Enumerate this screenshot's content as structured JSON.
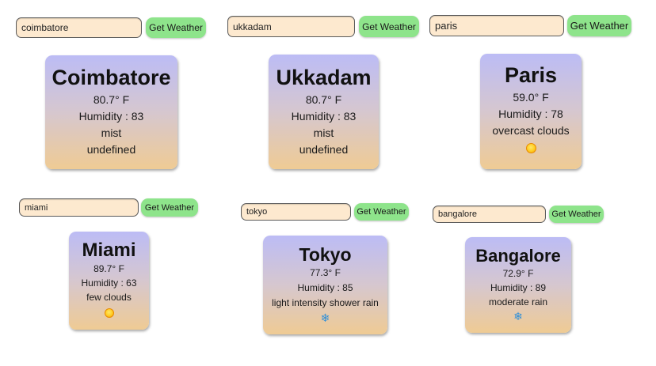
{
  "button_label": "Get Weather",
  "widgets": [
    {
      "query": "coimbatore",
      "city": "Coimbatore",
      "temperature": "80.7° F",
      "humidity": "Humidity : 83",
      "description": "mist",
      "extra": "undefined"
    },
    {
      "query": "ukkadam",
      "city": "Ukkadam",
      "temperature": "80.7° F",
      "humidity": "Humidity : 83",
      "description": "mist",
      "extra": "undefined"
    },
    {
      "query": "paris",
      "city": "Paris",
      "temperature": "59.0° F",
      "humidity": "Humidity : 78",
      "description": "overcast clouds",
      "icon": "sun-icon"
    },
    {
      "query": "miami",
      "city": "Miami",
      "temperature": "89.7° F",
      "humidity": "Humidity : 63",
      "description": "few clouds",
      "icon": "sun-icon"
    },
    {
      "query": "tokyo",
      "city": "Tokyo",
      "temperature": "77.3° F",
      "humidity": "Humidity : 85",
      "description": "light intensity shower rain",
      "icon": "snowflake-icon"
    },
    {
      "query": "bangalore",
      "city": "Bangalore",
      "temperature": "72.9° F",
      "humidity": "Humidity : 89",
      "description": "moderate rain",
      "icon": "snowflake-icon"
    }
  ],
  "colors": {
    "input_background": "#fde9cf",
    "button_background": "#8ee48b",
    "card_gradient_top": "#bcbcf5",
    "card_gradient_bottom": "#efcb94",
    "snowflake": "#2f8fd9"
  }
}
